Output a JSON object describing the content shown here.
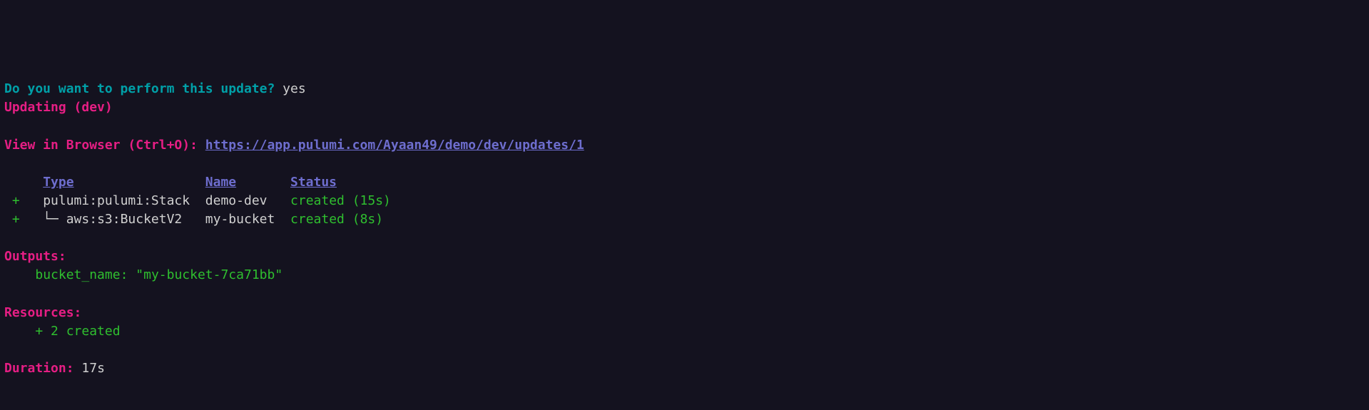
{
  "prompt": {
    "question": "Do you want to perform this update?",
    "answer": "yes"
  },
  "updating_line": "Updating (dev)",
  "view_browser_label": "View in Browser (Ctrl+O): ",
  "view_browser_url": "https://app.pulumi.com/Ayaan49/demo/dev/updates/1",
  "table": {
    "headers": {
      "type": "Type",
      "name": "Name",
      "status": "Status"
    },
    "rows": [
      {
        "op": "+",
        "indent": "",
        "tree": "",
        "type": "pulumi:pulumi:Stack",
        "name": "demo-dev",
        "status": "created (15s)"
      },
      {
        "op": "+",
        "indent": "",
        "tree": "└─ ",
        "type": "aws:s3:BucketV2",
        "name": "my-bucket",
        "status": "created (8s)"
      }
    ]
  },
  "outputs": {
    "label": "Outputs:",
    "entries": [
      {
        "key": "bucket_name",
        "value": "\"my-bucket-7ca71bb\""
      }
    ]
  },
  "resources": {
    "label": "Resources:",
    "summary": "+ 2 created"
  },
  "duration": {
    "label": "Duration:",
    "value": "17s"
  }
}
